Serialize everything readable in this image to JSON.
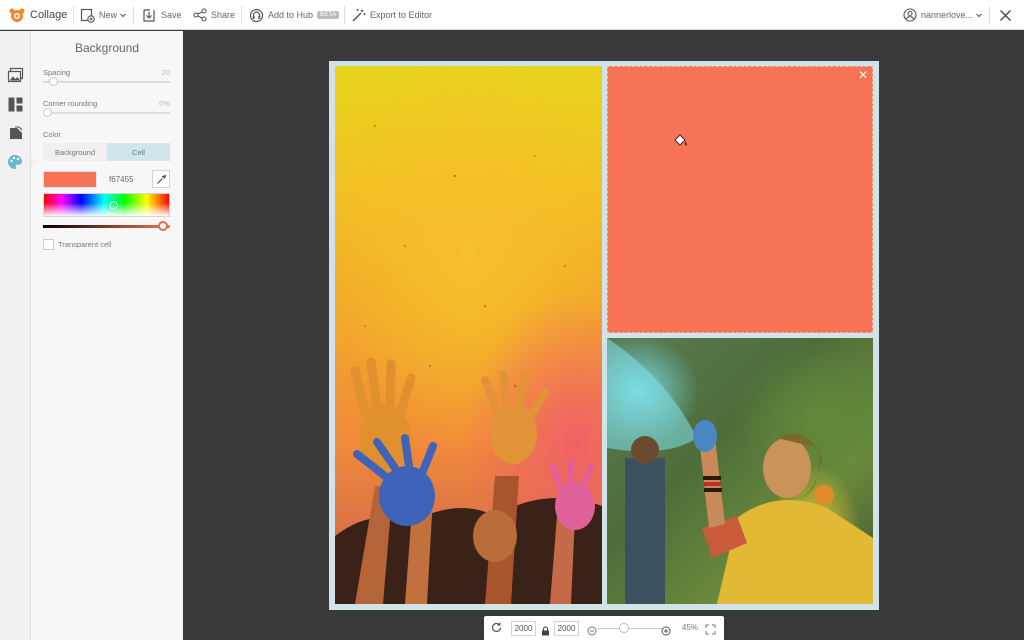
{
  "app": {
    "name": "Collage"
  },
  "toolbar": {
    "new_label": "New",
    "save_label": "Save",
    "share_label": "Share",
    "hub_label": "Add to Hub",
    "hub_badge": "BETA",
    "export_label": "Export to Editor",
    "user_label": "nannerlove..."
  },
  "panel": {
    "title": "Background",
    "spacing_label": "Spacing",
    "spacing_value": "20",
    "spacing_level": 0.05,
    "corner_label": "Corner rounding",
    "corner_value": "0%",
    "corner_level": 0,
    "color_label": "Color",
    "tab_background": "Background",
    "tab_cell": "Cell",
    "hex_value": "f67455",
    "transparent_label": "Transparent cell"
  },
  "colors": {
    "selected": "#f67455",
    "accent_tab": "#cfe6ec",
    "frame": "#cfe3e8"
  },
  "icons": {
    "logo": "collage-logo-icon",
    "new": "new-document-icon",
    "save": "save-icon",
    "share": "share-icon",
    "hub": "hub-icon",
    "export": "magic-wand-icon",
    "user": "user-icon",
    "close": "close-icon",
    "rail": [
      "photos-icon",
      "layouts-icon",
      "stickers-icon",
      "background-palette-icon"
    ]
  },
  "canvas": {
    "width": "2000",
    "height": "2000",
    "zoom": "45%",
    "cells": [
      {
        "content": "holi-hands-photo"
      },
      {
        "content": "solid-color",
        "color": "#f67455"
      },
      {
        "content": "holi-woman-photo"
      }
    ]
  }
}
